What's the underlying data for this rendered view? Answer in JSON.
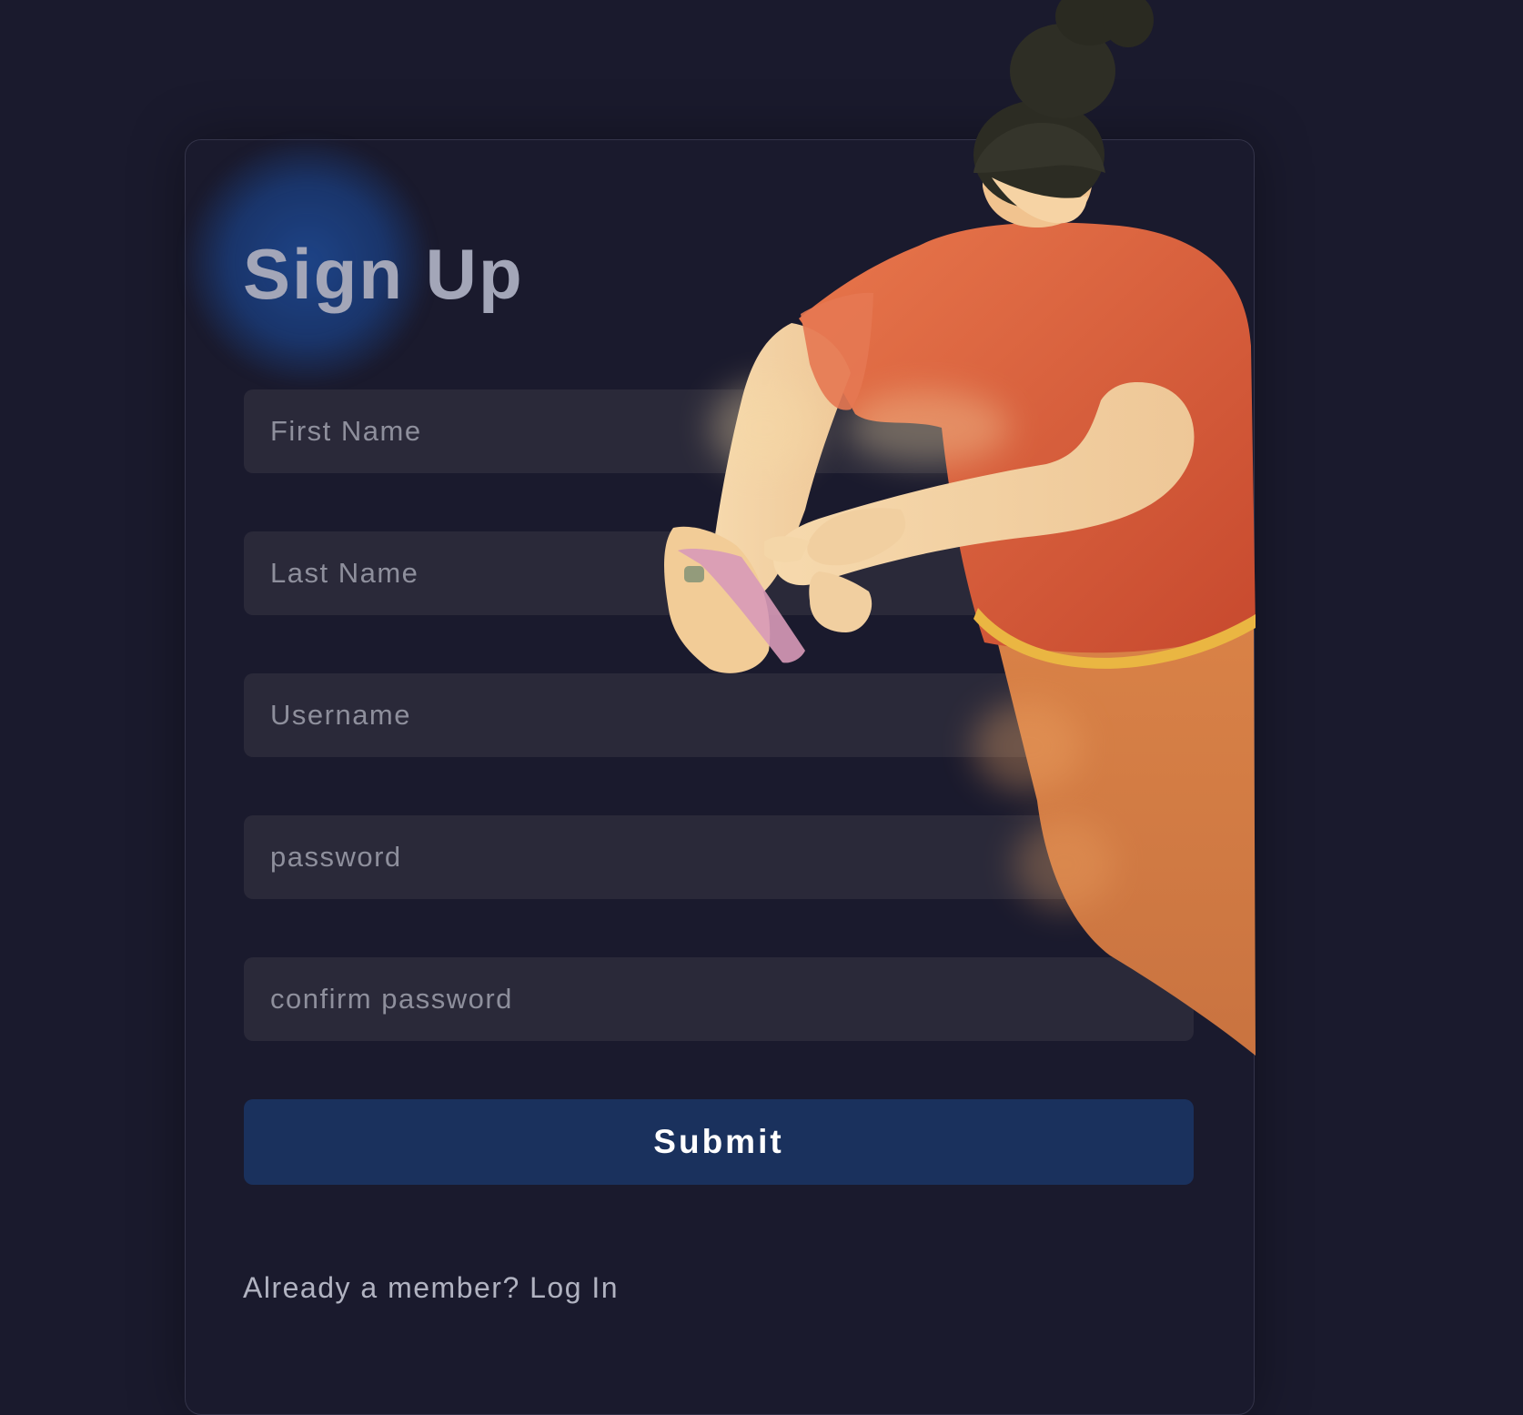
{
  "form": {
    "title": "Sign Up",
    "fields": [
      {
        "placeholder": "First Name",
        "value": ""
      },
      {
        "placeholder": "Last Name",
        "value": ""
      },
      {
        "placeholder": "Username",
        "value": ""
      },
      {
        "placeholder": "password",
        "value": ""
      },
      {
        "placeholder": "confirm password",
        "value": ""
      }
    ],
    "submit_label": "Submit",
    "footer_prefix": "Already a member?",
    "footer_link": "Log In"
  },
  "colors": {
    "background": "#1a1a2d",
    "field_background": "#2a2939",
    "submit_background": "#1a315d",
    "glow": "#1e468c",
    "shirt": "#e06a45",
    "skirt": "#d07a45",
    "skin": "#f3d3a7",
    "hair": "#2a2a22"
  },
  "illustration": {
    "name": "woman-using-phone-illustration"
  }
}
